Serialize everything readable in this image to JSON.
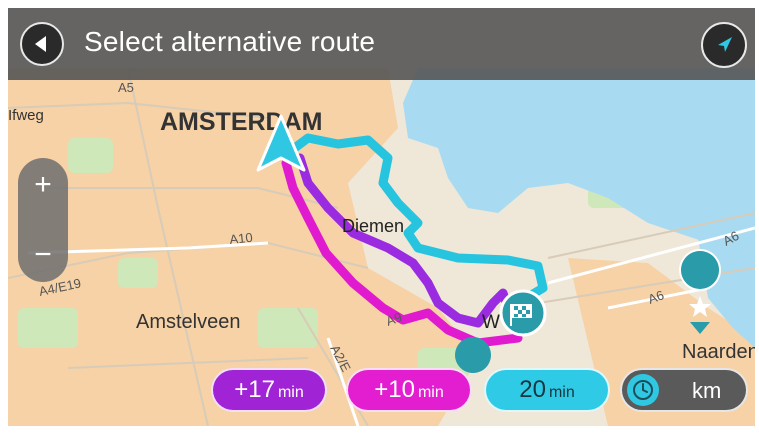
{
  "header": {
    "title": "Select alternative route"
  },
  "map": {
    "labels": {
      "amsterdam": "AMSTERDAM",
      "amstelveen": "Amstelveen",
      "diemen": "Diemen",
      "naarden": "Naarden",
      "ifweg": "Ifweg",
      "w": "W"
    },
    "roads": {
      "a5": "A5",
      "a10": "A10",
      "a4e19": "A4/E19",
      "a9": "A9",
      "a2e": "A2/E",
      "a6_top": "A6",
      "a6_mid": "A6"
    }
  },
  "zoom": {
    "in_label": "+",
    "out_label": "−"
  },
  "routes": [
    {
      "num": "+17",
      "unit": "min",
      "color": "#a024d6"
    },
    {
      "num": "+10",
      "unit": "min",
      "color": "#e21ed0"
    },
    {
      "num": "20",
      "unit": "min",
      "color": "#2fcbe6"
    }
  ],
  "units_toggle": {
    "label": "km"
  },
  "colors": {
    "water": "#a9dcf2",
    "land": "#efe7d8",
    "urban": "#f7d3a8",
    "green": "#c9e7b7",
    "header": "#555555"
  }
}
